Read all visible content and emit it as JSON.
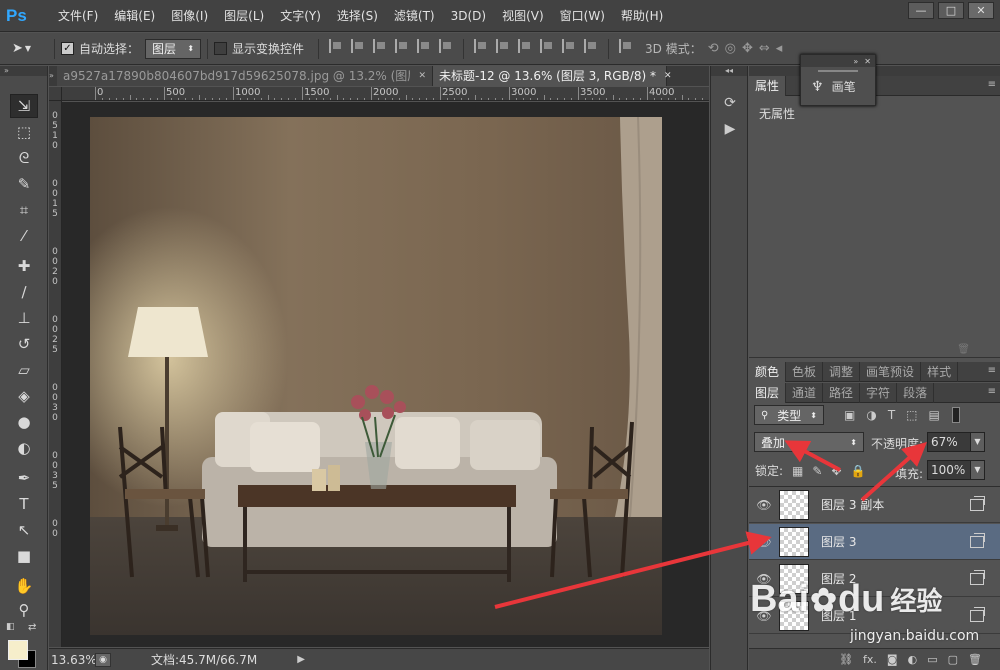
{
  "app": {
    "logo": "Ps"
  },
  "menu": [
    "文件(F)",
    "编辑(E)",
    "图像(I)",
    "图层(L)",
    "文字(Y)",
    "选择(S)",
    "滤镜(T)",
    "3D(D)",
    "视图(V)",
    "窗口(W)",
    "帮助(H)"
  ],
  "window_controls": {
    "minimize": "—",
    "maximize": "□",
    "close": "✕"
  },
  "options_bar": {
    "auto_select_label": "自动选择：",
    "auto_select_checked": true,
    "auto_select_target": "图层",
    "show_transform_label": "显示变换控件",
    "show_transform_checked": false,
    "mode_3d_label": "3D 模式："
  },
  "tabs": [
    {
      "label": "a9527a17890b804607bd917d59625078.jpg @ 13.2% (图层 1, R...",
      "active": false,
      "close": "✕"
    },
    {
      "label": "未标题-12 @ 13.6% (图层 3, RGB/8) *",
      "active": true,
      "close": "✕"
    }
  ],
  "ruler_top": [
    "0",
    "500",
    "1000",
    "1500",
    "2000",
    "2500",
    "3000",
    "3500",
    "4000"
  ],
  "ruler_left": [
    "0",
    "5",
    "1",
    "0",
    "0",
    "0",
    "1",
    "5",
    "0",
    "0",
    "2",
    "0",
    "0",
    "0",
    "2",
    "5",
    "0",
    "0",
    "3",
    "0",
    "0",
    "0",
    "3",
    "5",
    "0",
    "0"
  ],
  "status": {
    "zoom": "13.63%",
    "doc_size": "文档:45.7M/66.7M"
  },
  "brush_panel": {
    "label": "画笔"
  },
  "properties_panel": {
    "tab": "属性",
    "content": "无属性"
  },
  "color_panel_tabs": [
    "颜色",
    "色板",
    "调整",
    "画笔预设",
    "样式"
  ],
  "layers_panel": {
    "tabs": [
      "图层",
      "通道",
      "路径",
      "字符",
      "段落"
    ],
    "filter_kind": "类型",
    "blend_mode": "叠加",
    "opacity_label": "不透明度:",
    "opacity_value": "67%",
    "lock_label": "锁定:",
    "fill_label": "填充:",
    "fill_value": "100%",
    "layers": [
      {
        "name": "图层 3 副本",
        "selected": false
      },
      {
        "name": "图层 3",
        "selected": true
      },
      {
        "name": "图层 2",
        "selected": false
      },
      {
        "name": "图层 1",
        "selected": false
      }
    ],
    "footer_icons": [
      "link-icon",
      "fx-icon",
      "mask-icon",
      "adjustment-icon",
      "group-icon",
      "new-layer-icon",
      "trash-icon"
    ],
    "fx_label": "fx."
  },
  "watermark": {
    "brand": "Bai",
    "brand2": "du",
    "cn": "经验",
    "url": "jingyan.baidu.com"
  },
  "colors": {
    "foreground": "#f6eecb",
    "background": "#000000",
    "accent_arrow": "#e8363a",
    "selected_layer": "#5a6b82"
  }
}
